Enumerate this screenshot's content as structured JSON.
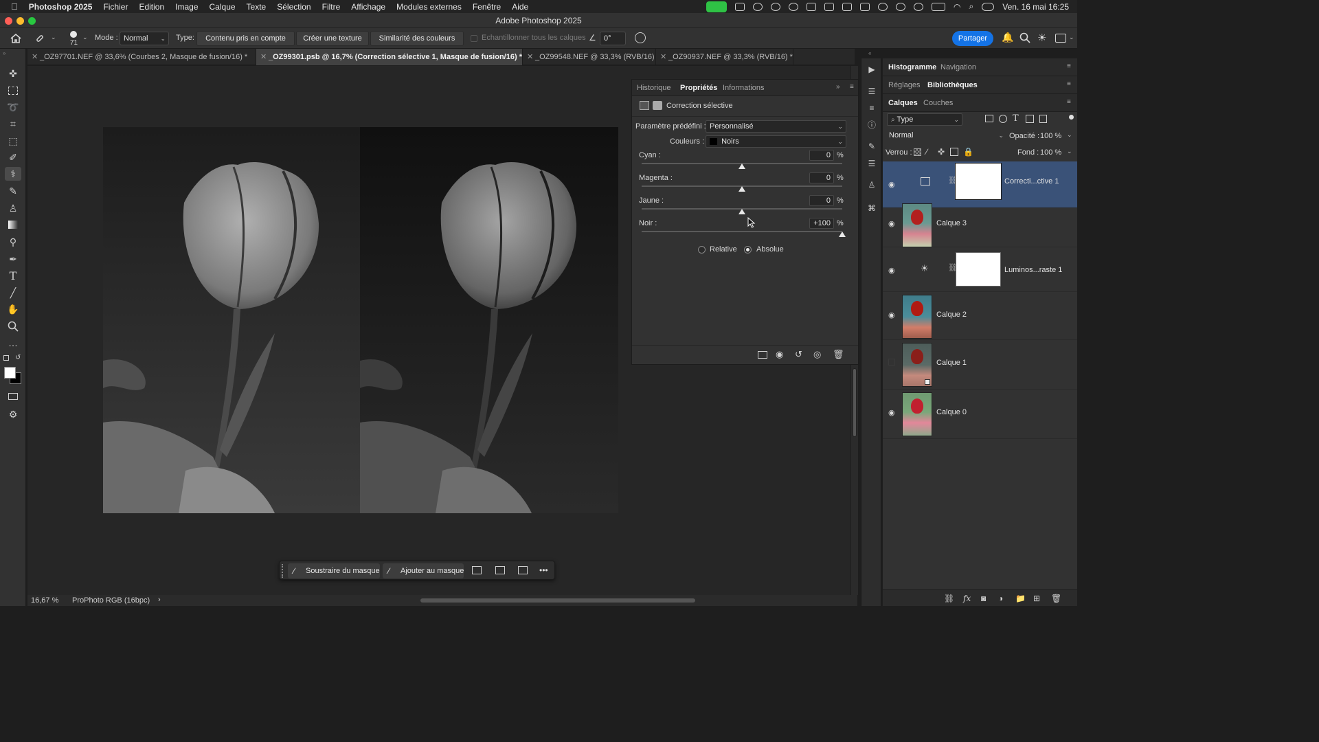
{
  "menubar": {
    "app": "Photoshop 2025",
    "items": [
      "Fichier",
      "Edition",
      "Image",
      "Calque",
      "Texte",
      "Sélection",
      "Filtre",
      "Affichage",
      "Modules externes",
      "Fenêtre",
      "Aide"
    ],
    "datetime": "Ven. 16 mai  16:25"
  },
  "window": {
    "title": "Adobe Photoshop 2025"
  },
  "options": {
    "brush_size": "71",
    "mode_label": "Mode :",
    "mode_value": "Normal",
    "type_label": "Type:",
    "type_buttons": [
      "Contenu pris en compte",
      "Créer une texture",
      "Similarité des couleurs"
    ],
    "sample_all": "Echantillonner tous les calques",
    "angle": "0°",
    "share": "Partager"
  },
  "tabs": [
    "_OZ97701.NEF @ 33,6% (Courbes 2, Masque de fusion/16) *",
    "_OZ99301.psb @ 16,7% (Correction sélective 1, Masque de fusion/16) *",
    "_OZ99548.NEF @ 33,3% (RVB/16)",
    "_OZ90937.NEF @ 33,3% (RVB/16) *"
  ],
  "status": {
    "zoom": "16,67 %",
    "profile": "ProPhoto RGB (16bpc)",
    "arrow": "›"
  },
  "taskbar": {
    "subtract": "Soustraire du masque",
    "add": "Ajouter au masque",
    "more": "•••"
  },
  "properties": {
    "tabs": [
      "Historique",
      "Propriétés",
      "Informations"
    ],
    "header": "Correction sélective",
    "preset_label": "Paramètre prédéfini :",
    "preset_value": "Personnalisé",
    "colors_label": "Couleurs :",
    "colors_value": "Noirs",
    "sliders": [
      {
        "label": "Cyan :",
        "value": "0",
        "level": 0
      },
      {
        "label": "Magenta :",
        "value": "0",
        "level": 0
      },
      {
        "label": "Jaune :",
        "value": "0",
        "level": 0
      },
      {
        "label": "Noir :",
        "value": "+100",
        "level": 100
      }
    ],
    "percent": "%",
    "methods": [
      "Relative",
      "Absolue"
    ],
    "selected_method": "Absolue"
  },
  "dock": {
    "row1_tabs": [
      "Histogramme",
      "Navigation"
    ],
    "row2_tabs": [
      "Réglages",
      "Bibliothèques"
    ],
    "row3_tabs": [
      "Calques",
      "Couches"
    ],
    "filter_value": "Type",
    "blend_value": "Normal",
    "opacity_label": "Opacité :",
    "opacity_value": "100 %",
    "lock_label": "Verrou :",
    "fill_label": "Fond :",
    "fill_value": "100 %"
  },
  "layers": [
    {
      "name": "Correcti...ctive 1",
      "kind": "adjustment",
      "visible": true,
      "selected": true
    },
    {
      "name": "Calque 3",
      "kind": "image",
      "visible": true,
      "selected": false
    },
    {
      "name": "Luminos...raste 1",
      "kind": "adjustment",
      "visible": true,
      "selected": false
    },
    {
      "name": "Calque 2",
      "kind": "image",
      "visible": true,
      "selected": false
    },
    {
      "name": "Calque 1",
      "kind": "image",
      "visible": false,
      "selected": false
    },
    {
      "name": "Calque 0",
      "kind": "image",
      "visible": true,
      "selected": false
    }
  ],
  "colors": {
    "accent": "#1473e6",
    "selected_layer": "#3a5278",
    "panel": "#323232"
  }
}
